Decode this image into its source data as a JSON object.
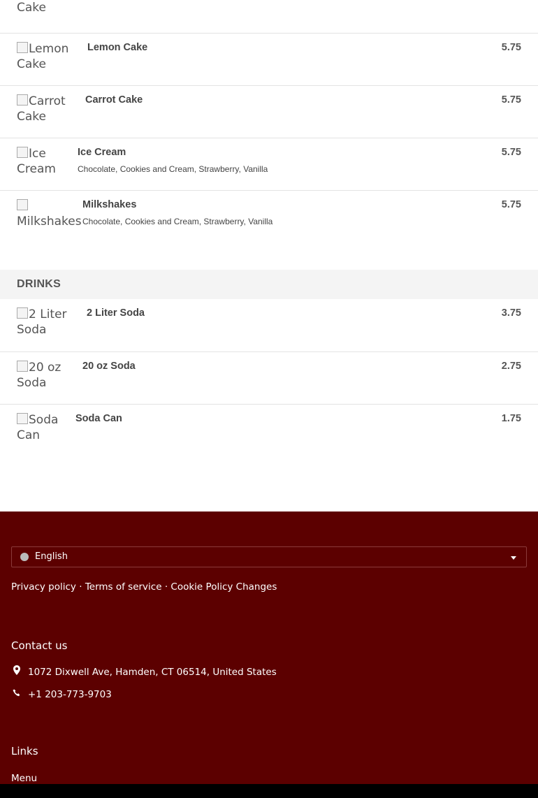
{
  "menu": {
    "top_partial": {
      "thumb_alt": "Cake",
      "price": ""
    },
    "items": [
      {
        "thumb_alt": "Lemon Cake",
        "name": "Lemon Cake",
        "desc": "",
        "price": "5.75"
      },
      {
        "thumb_alt": "Carrot Cake",
        "name": "Carrot Cake",
        "desc": "",
        "price": "5.75"
      },
      {
        "thumb_alt": "Ice Cream",
        "name": "Ice Cream",
        "desc": "Chocolate, Cookies and Cream, Strawberry, Vanilla",
        "price": "5.75"
      },
      {
        "thumb_alt": "Milkshakes",
        "name": "Milkshakes",
        "desc": "Chocolate, Cookies and Cream, Strawberry, Vanilla",
        "price": "5.75"
      }
    ],
    "drinks_heading": "DRINKS",
    "drinks": [
      {
        "thumb_alt": "2 Liter Soda",
        "name": "2 Liter Soda",
        "price": "3.75"
      },
      {
        "thumb_alt": "20 oz Soda",
        "name": "20 oz Soda",
        "price": "2.75"
      },
      {
        "thumb_alt": "Soda Can",
        "name": "Soda Can",
        "price": "1.75"
      }
    ]
  },
  "footer": {
    "language": "English",
    "privacy": "Privacy policy",
    "sep": "·",
    "terms": "Terms of service",
    "cookie": "Cookie Policy Changes",
    "contact_heading": "Contact us",
    "address": "1072 Dixwell Ave, Hamden, CT 06514, United States",
    "phone": "+1 203-773-9703",
    "links_heading": "Links",
    "menu_link": "Menu"
  },
  "colors": {
    "footer_bg": "#5c0000",
    "section_bg": "#f4f4f4"
  },
  "icons": {
    "language": "globe-icon",
    "dropdown": "caret-down-icon",
    "address": "map-pin-icon",
    "phone": "phone-icon"
  }
}
